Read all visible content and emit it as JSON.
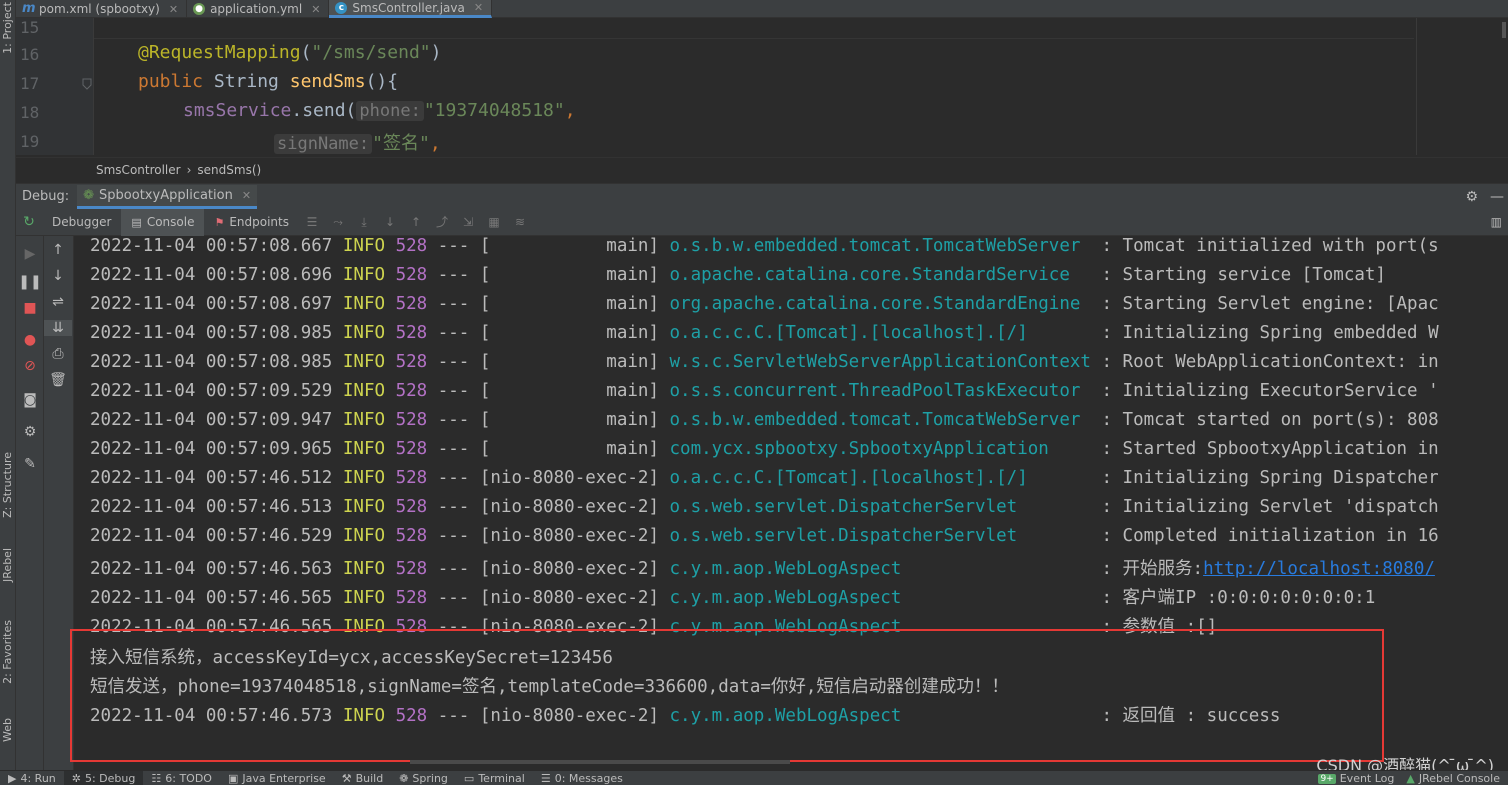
{
  "left_strip": {
    "project": "1: Project",
    "structure": "Z: Structure",
    "jrebel": "JRebel",
    "favorites": "2: Favorites",
    "web": "Web"
  },
  "editor_tabs": [
    {
      "label": "pom.xml (spbootxy)",
      "icon": "maven-icon",
      "active": false
    },
    {
      "label": "application.yml",
      "icon": "yaml-icon",
      "active": false
    },
    {
      "label": "SmsController.java",
      "icon": "java-class-icon",
      "active": true
    }
  ],
  "editor": {
    "line_numbers": [
      "15",
      "16",
      "17",
      "18",
      "19"
    ],
    "line16": {
      "annotation": "@RequestMapping",
      "p1": "(",
      "str": "\"/sms/send\"",
      "p2": ")"
    },
    "line17": {
      "kw": "public",
      "type": " String ",
      "fn": "sendSms",
      "rest": "(){"
    },
    "line18": {
      "fld": "smsService",
      "call": ".send(",
      "hint": "phone:",
      "str": "\"19374048518\"",
      "comma": ","
    },
    "line19": {
      "hint": "signName:",
      "str": "\"签名\"",
      "comma": ","
    }
  },
  "breadcrumb": {
    "class": "SmsController",
    "sep": "›",
    "method": "sendSms()"
  },
  "debug": {
    "label": "Debug:",
    "run_config": "SpbootxyApplication",
    "tabs": [
      {
        "label": "Debugger",
        "active": false
      },
      {
        "label": "Console",
        "active": true
      },
      {
        "label": "Endpoints",
        "active": false
      }
    ]
  },
  "console": {
    "lines": [
      {
        "ts": "2022-11-04 00:57:08.667",
        "level": "INFO",
        "pid": "528",
        "thread": " --- [           main] ",
        "logger": "o.s.b.w.embedded.tomcat.TomcatWebServer ",
        "msg": " : Tomcat initialized with port(s"
      },
      {
        "ts": "2022-11-04 00:57:08.696",
        "level": "INFO",
        "pid": "528",
        "thread": " --- [           main] ",
        "logger": "o.apache.catalina.core.StandardService  ",
        "msg": " : Starting service [Tomcat]"
      },
      {
        "ts": "2022-11-04 00:57:08.697",
        "level": "INFO",
        "pid": "528",
        "thread": " --- [           main] ",
        "logger": "org.apache.catalina.core.StandardEngine ",
        "msg": " : Starting Servlet engine: [Apac"
      },
      {
        "ts": "2022-11-04 00:57:08.985",
        "level": "INFO",
        "pid": "528",
        "thread": " --- [           main] ",
        "logger": "o.a.c.c.C.[Tomcat].[localhost].[/]      ",
        "msg": " : Initializing Spring embedded W"
      },
      {
        "ts": "2022-11-04 00:57:08.985",
        "level": "INFO",
        "pid": "528",
        "thread": " --- [           main] ",
        "logger": "w.s.c.ServletWebServerApplicationContext",
        "msg": " : Root WebApplicationContext: in"
      },
      {
        "ts": "2022-11-04 00:57:09.529",
        "level": "INFO",
        "pid": "528",
        "thread": " --- [           main] ",
        "logger": "o.s.s.concurrent.ThreadPoolTaskExecutor ",
        "msg": " : Initializing ExecutorService '"
      },
      {
        "ts": "2022-11-04 00:57:09.947",
        "level": "INFO",
        "pid": "528",
        "thread": " --- [           main] ",
        "logger": "o.s.b.w.embedded.tomcat.TomcatWebServer ",
        "msg": " : Tomcat started on port(s): 808"
      },
      {
        "ts": "2022-11-04 00:57:09.965",
        "level": "INFO",
        "pid": "528",
        "thread": " --- [           main] ",
        "logger": "com.ycx.spbootxy.SpbootxyApplication    ",
        "msg": " : Started SpbootxyApplication in"
      },
      {
        "ts": "2022-11-04 00:57:46.512",
        "level": "INFO",
        "pid": "528",
        "thread": " --- [nio-8080-exec-2] ",
        "logger": "o.a.c.c.C.[Tomcat].[localhost].[/]      ",
        "msg": " : Initializing Spring Dispatcher"
      },
      {
        "ts": "2022-11-04 00:57:46.513",
        "level": "INFO",
        "pid": "528",
        "thread": " --- [nio-8080-exec-2] ",
        "logger": "o.s.web.servlet.DispatcherServlet       ",
        "msg": " : Initializing Servlet 'dispatch"
      },
      {
        "ts": "2022-11-04 00:57:46.529",
        "level": "INFO",
        "pid": "528",
        "thread": " --- [nio-8080-exec-2] ",
        "logger": "o.s.web.servlet.DispatcherServlet       ",
        "msg": " : Completed initialization in 16"
      },
      {
        "ts": "2022-11-04 00:57:46.563",
        "level": "INFO",
        "pid": "528",
        "thread": " --- [nio-8080-exec-2] ",
        "logger": "c.y.m.aop.WebLogAspect                  ",
        "msg": " : 开始服务:",
        "link": "http://localhost:8080/"
      },
      {
        "ts": "2022-11-04 00:57:46.565",
        "level": "INFO",
        "pid": "528",
        "thread": " --- [nio-8080-exec-2] ",
        "logger": "c.y.m.aop.WebLogAspect                  ",
        "msg": " : 客户端IP :0:0:0:0:0:0:0:1"
      },
      {
        "ts": "2022-11-04 00:57:46.565",
        "level": "INFO",
        "pid": "528",
        "thread": " --- [nio-8080-exec-2] ",
        "logger": "c.y.m.aop.WebLogAspect                  ",
        "msg": " : 参数值 :[]"
      }
    ],
    "plain1": "接入短信系统，accessKeyId=ycx,accessKeySecret=123456",
    "plain2": "短信发送，phone=19374048518,signName=签名,templateCode=336600,data=你好,短信启动器创建成功！！",
    "last": {
      "ts": "2022-11-04 00:57:46.573",
      "level": "INFO",
      "pid": "528",
      "thread": " --- [nio-8080-exec-2] ",
      "logger": "c.y.m.aop.WebLogAspect                  ",
      "msg": " : 返回值 : success"
    }
  },
  "status_bar": [
    {
      "label": "4: Run",
      "icon": "run-icon",
      "active": false
    },
    {
      "label": "5: Debug",
      "icon": "debug-icon",
      "active": true
    },
    {
      "label": "6: TODO",
      "icon": "todo-icon",
      "active": false
    },
    {
      "label": "Java Enterprise",
      "icon": "enterprise-icon",
      "active": false
    },
    {
      "label": "Build",
      "icon": "build-icon",
      "active": false
    },
    {
      "label": "Spring",
      "icon": "spring-icon",
      "active": false
    },
    {
      "label": "Terminal",
      "icon": "terminal-icon",
      "active": false
    },
    {
      "label": "0: Messages",
      "icon": "messages-icon",
      "active": false
    }
  ],
  "status_right": {
    "event_log": "Event Log",
    "event_badge": "9+",
    "jrebel_console": "JRebel Console"
  },
  "watermark": "CSDN @酒醉猫(^ ̄ω ̄^)"
}
